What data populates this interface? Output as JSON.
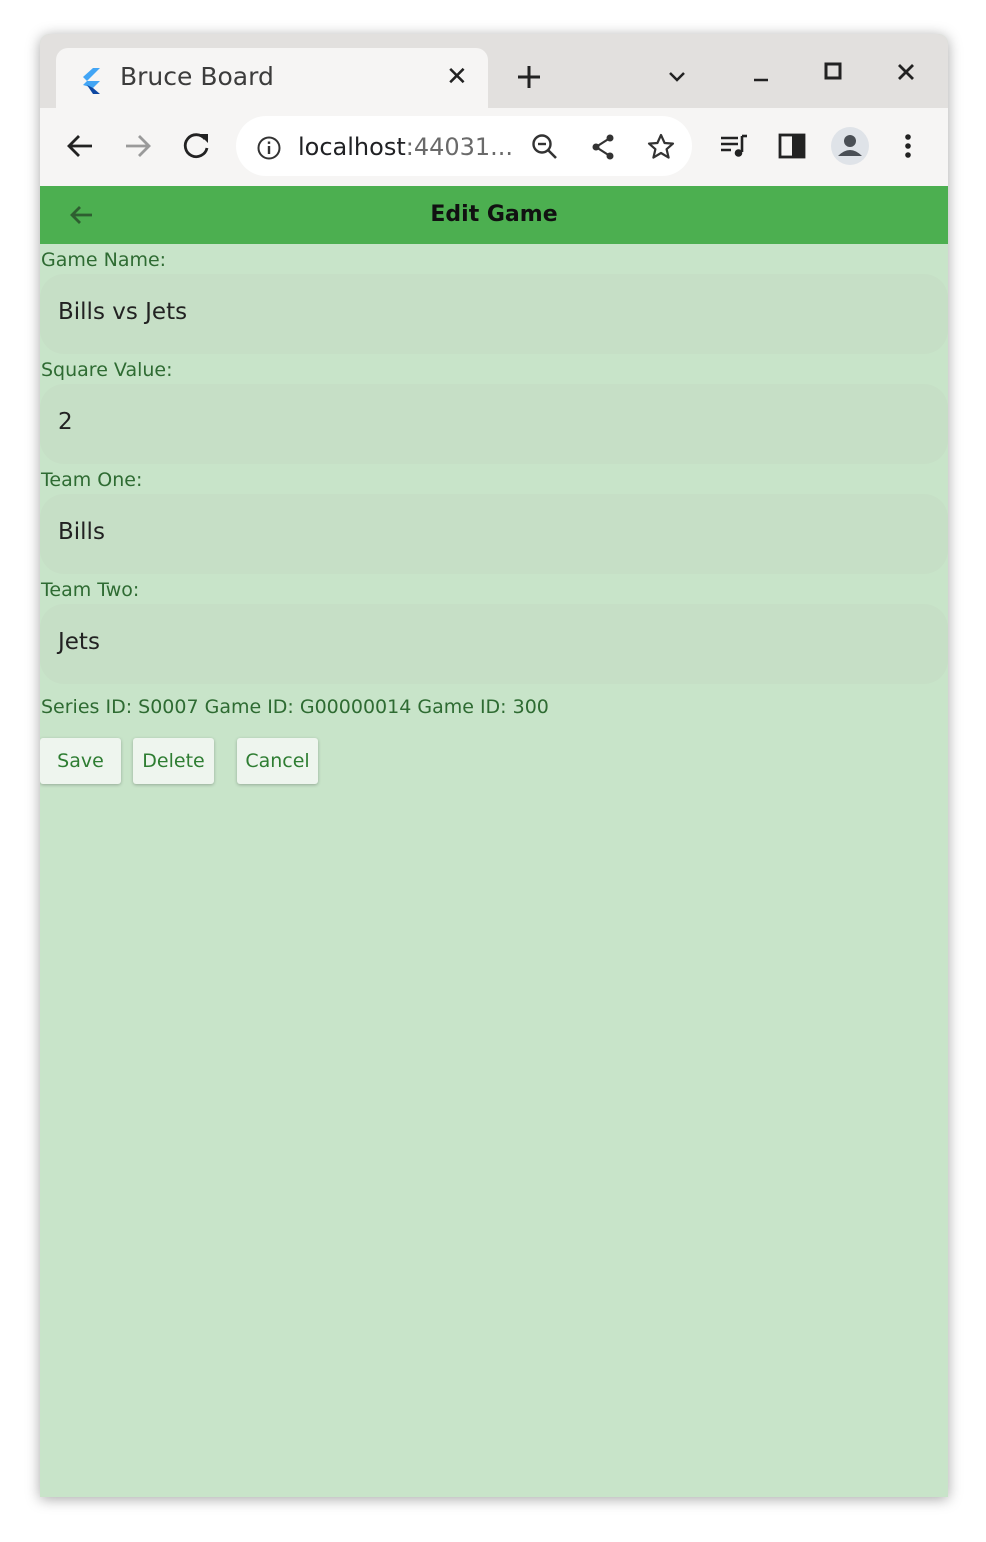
{
  "browser": {
    "tab_title": "Bruce Board",
    "url_host": "localhost",
    "url_port": ":44031..."
  },
  "app": {
    "title": "Edit Game",
    "accent_color": "#4caf50",
    "background_color": "#c8e4c9"
  },
  "form": {
    "fields": [
      {
        "label": "Game Name:",
        "value": "Bills vs Jets"
      },
      {
        "label": "Square Value:",
        "value": "2"
      },
      {
        "label": "Team One:",
        "value": "Bills"
      },
      {
        "label": "Team Two:",
        "value": "Jets"
      }
    ],
    "ids_text": "Series ID: S0007 Game ID: G00000014 Game ID: 300"
  },
  "buttons": {
    "save": "Save",
    "delete": "Delete",
    "cancel": "Cancel"
  }
}
